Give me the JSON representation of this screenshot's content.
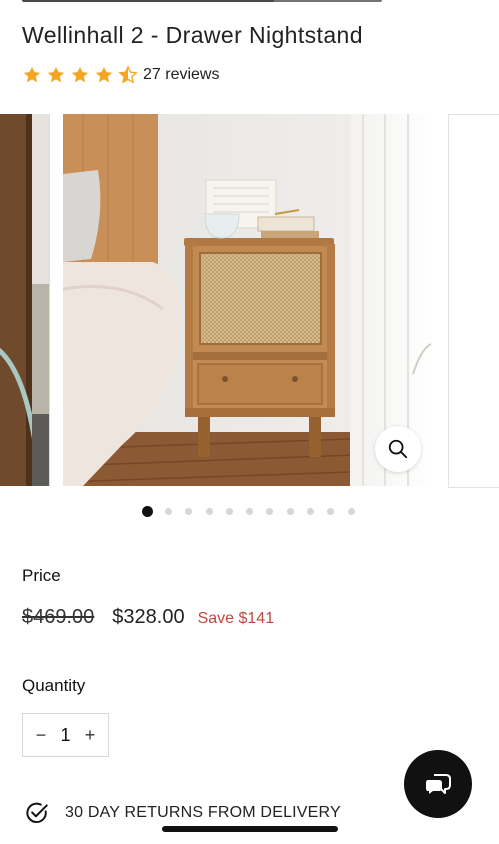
{
  "product": {
    "title": "Wellinhall 2 - Drawer Nightstand",
    "rating": {
      "stars": 4.5,
      "max": 5,
      "reviews_label": "27 reviews"
    }
  },
  "gallery": {
    "slide_count": 11,
    "active_index": 0,
    "zoom_icon": "search-icon"
  },
  "price": {
    "label": "Price",
    "compare_at": "$469.00",
    "sale": "$328.00",
    "save": "Save $141"
  },
  "quantity": {
    "label": "Quantity",
    "value": "1",
    "decrement": "−",
    "increment": "+"
  },
  "returns": {
    "icon": "check-circle-icon",
    "text": "30 DAY RETURNS FROM DELIVERY"
  },
  "chat": {
    "icon": "chat-bubbles-icon"
  },
  "colors": {
    "star": "#f3a524",
    "sale_red": "#c0473f",
    "dot_active": "#111111",
    "dot_inactive": "#d6d6d6"
  }
}
